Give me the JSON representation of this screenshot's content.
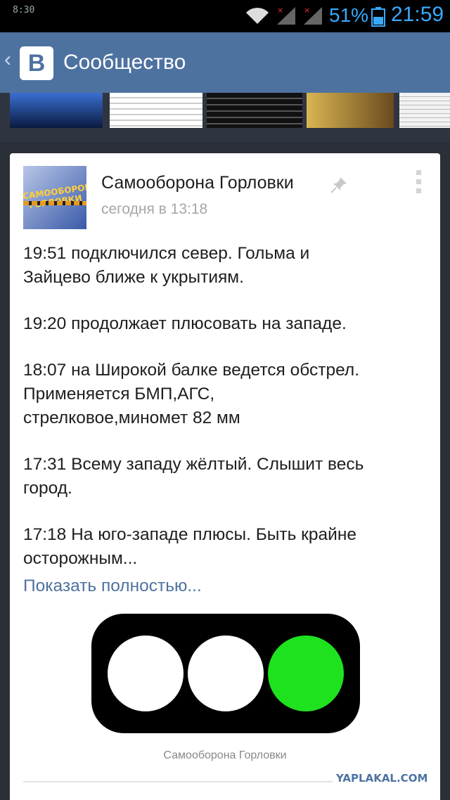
{
  "status_bar": {
    "left_time": "8:30",
    "battery_pct": "51%",
    "time": "21:59"
  },
  "app_bar": {
    "back_symbol": "‹",
    "logo": "B",
    "title": "Сообщество"
  },
  "post": {
    "author": "Самооборона Горловки",
    "date": "сегодня в 13:18",
    "paragraphs": [
      "19:51 подключился север. Гольма и\nЗайцево ближе к укрытиям.",
      "19:20 продолжает плюсовать на западе.",
      "18:07 на Широкой балке ведется обстрел.\nПрименяется БМП,АГС,\nстрелковое,миномет 82 мм",
      "17:31 Всему западу жёлтый. Слышит весь\nгород.",
      "17:18 На юго-западе плюсы. Быть крайне\nосторожным..."
    ],
    "show_more": "Показать полностью...",
    "image_caption": "Самооборона Горловки",
    "traffic_light": {
      "lights": [
        "white",
        "white",
        "green"
      ],
      "colors": {
        "white": "#ffffff",
        "green": "#1ee21e",
        "body": "#000000"
      }
    }
  },
  "watermark": "YAPLAKAL.COM",
  "colors": {
    "app_bar": "#4e72a0",
    "link": "#4e72a0",
    "status_text": "#38a9ff"
  }
}
